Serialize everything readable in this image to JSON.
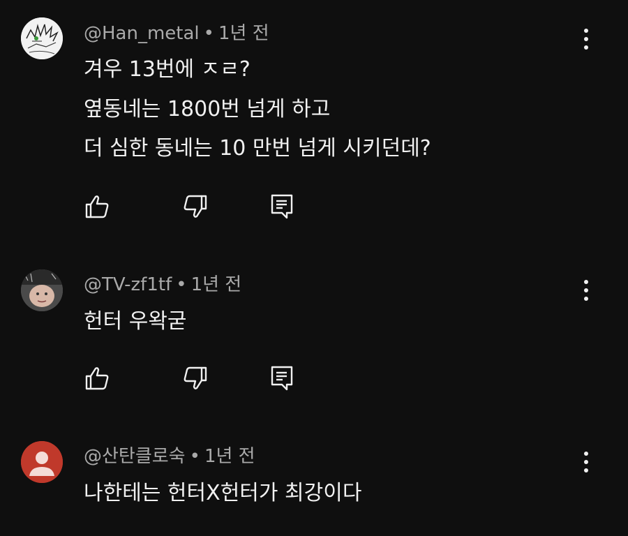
{
  "comments": [
    {
      "author": "@Han_metal",
      "separator": "•",
      "time": "1년 전",
      "lines": [
        "겨우 13번에 ㅈㄹ?",
        "옆동네는 1800번 넘게 하고",
        "더 심한 동네는 10 만번 넘게 시키던데?"
      ],
      "avatar_icon": "sketch-avatar-icon"
    },
    {
      "author": "@TV-zf1tf",
      "separator": "•",
      "time": "1년 전",
      "lines": [
        "헌터 우왁굳"
      ],
      "avatar_icon": "photo-avatar-icon"
    },
    {
      "author": "@산탄클로숙",
      "separator": "•",
      "time": "1년 전",
      "lines": [
        "나한테는 헌터X헌터가 최강이다"
      ],
      "avatar_icon": "default-user-avatar-icon",
      "avatar_color": "#c0392b"
    }
  ],
  "actions": {
    "like_icon": "thumbs-up-icon",
    "dislike_icon": "thumbs-down-icon",
    "reply_icon": "reply-icon",
    "more_icon": "more-vertical-icon"
  },
  "colors": {
    "background": "#0f0f0f",
    "text": "#f1f1f1",
    "secondary_text": "#aaaaaa"
  }
}
